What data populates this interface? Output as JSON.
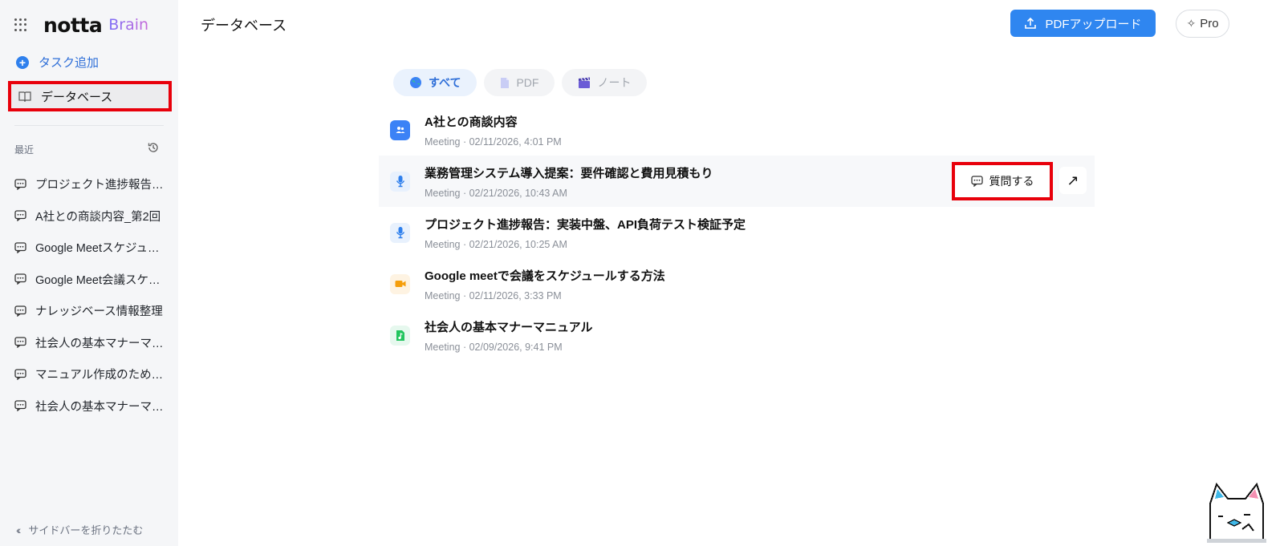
{
  "brand": {
    "logo": "notta",
    "product": "Brain"
  },
  "sidebar": {
    "add_task": "タスク追加",
    "database": "データベース",
    "recent_label": "最近",
    "recent_items": [
      "プロジェクト進捗報告：実装中盤、API負荷テスト検証予定",
      "A社との商談内容_第2回",
      "Google Meetスケジュール方法",
      "Google Meet会議スケジュール",
      "ナレッジベース情報整理",
      "社会人の基本マナーマニュアル",
      "マニュアル作成のための手順",
      "社会人の基本マナーマニュアル"
    ],
    "collapse": "サイドバーを折りたたむ"
  },
  "header": {
    "title": "データベース",
    "upload_button": "PDFアップロード",
    "pro_button": "Pro"
  },
  "tabs": [
    {
      "label": "すべて",
      "icon": "globe-icon",
      "active": true
    },
    {
      "label": "PDF",
      "icon": "pdf-icon",
      "active": false
    },
    {
      "label": "ノート",
      "icon": "clapperboard-icon",
      "active": false
    }
  ],
  "items": [
    {
      "title": "A社との商談内容",
      "meta": "Meeting · 02/11/2026, 4:01 PM",
      "icon": "folder-people-icon",
      "color": "#3b82f6"
    },
    {
      "title": "業務管理システム導入提案：要件確認と費用見積もり",
      "meta": "Meeting · 02/21/2026, 10:43 AM",
      "icon": "microphone-icon",
      "color": "#2f80ed"
    },
    {
      "title": "プロジェクト進捗報告：実装中盤、API負荷テスト検証予定",
      "meta": "Meeting · 02/21/2026, 10:25 AM",
      "icon": "microphone-icon",
      "color": "#2f80ed"
    },
    {
      "title": "Google meetで会議をスケジュールする方法",
      "meta": "Meeting · 02/11/2026, 3:33 PM",
      "icon": "video-icon",
      "color": "#f59e0b"
    },
    {
      "title": "社会人の基本マナーマニュアル",
      "meta": "Meeting · 02/09/2026, 9:41 PM",
      "icon": "music-file-icon",
      "color": "#22c55e"
    }
  ],
  "row_actions": {
    "ask": "質問する",
    "open": "↗"
  },
  "colors": {
    "accent": "#2f86f0",
    "highlight": "#e8000b"
  }
}
